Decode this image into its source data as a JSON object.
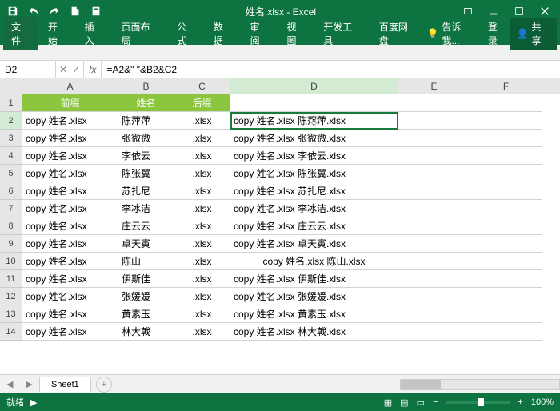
{
  "title": "姓名.xlsx - Excel",
  "ribbon": {
    "tabs": [
      "文件",
      "开始",
      "插入",
      "页面布局",
      "公式",
      "数据",
      "审阅",
      "视图",
      "开发工具",
      "百度网盘"
    ],
    "tell": "告诉我...",
    "login": "登录",
    "share": "共享"
  },
  "namebox": "D2",
  "formula": "=A2&\" \"&B2&C2",
  "columns": [
    "A",
    "B",
    "C",
    "D",
    "E",
    "F"
  ],
  "headers": {
    "A": "前缀",
    "B": "姓名",
    "C": "后缀"
  },
  "rows": [
    {
      "n": 2,
      "A": "copy 姓名.xlsx",
      "B": "陈萍萍",
      "C": ".xlsx",
      "D": "copy 姓名.xlsx 陈萍萍.xlsx"
    },
    {
      "n": 3,
      "A": "copy 姓名.xlsx",
      "B": "张微微",
      "C": ".xlsx",
      "D": "copy 姓名.xlsx 张微微.xlsx"
    },
    {
      "n": 4,
      "A": "copy 姓名.xlsx",
      "B": "李依云",
      "C": ".xlsx",
      "D": "copy 姓名.xlsx 李依云.xlsx"
    },
    {
      "n": 5,
      "A": "copy 姓名.xlsx",
      "B": "陈张翼",
      "C": ".xlsx",
      "D": "copy 姓名.xlsx 陈张翼.xlsx"
    },
    {
      "n": 6,
      "A": "copy 姓名.xlsx",
      "B": "苏扎尼",
      "C": ".xlsx",
      "D": "copy 姓名.xlsx 苏扎尼.xlsx"
    },
    {
      "n": 7,
      "A": "copy 姓名.xlsx",
      "B": "李冰洁",
      "C": ".xlsx",
      "D": "copy 姓名.xlsx 李冰洁.xlsx"
    },
    {
      "n": 8,
      "A": "copy 姓名.xlsx",
      "B": "庄云云",
      "C": ".xlsx",
      "D": "copy 姓名.xlsx 庄云云.xlsx"
    },
    {
      "n": 9,
      "A": "copy 姓名.xlsx",
      "B": "卓天寅",
      "C": ".xlsx",
      "D": "copy 姓名.xlsx 卓天寅.xlsx"
    },
    {
      "n": 10,
      "A": "copy 姓名.xlsx",
      "B": "陈山",
      "C": ".xlsx",
      "D": "copy 姓名.xlsx 陈山.xlsx"
    },
    {
      "n": 11,
      "A": "copy 姓名.xlsx",
      "B": "伊斯佳",
      "C": ".xlsx",
      "D": "copy 姓名.xlsx 伊斯佳.xlsx"
    },
    {
      "n": 12,
      "A": "copy 姓名.xlsx",
      "B": "张媛媛",
      "C": ".xlsx",
      "D": "copy 姓名.xlsx 张媛媛.xlsx"
    },
    {
      "n": 13,
      "A": "copy 姓名.xlsx",
      "B": "黄素玉",
      "C": ".xlsx",
      "D": "copy 姓名.xlsx 黄素玉.xlsx"
    },
    {
      "n": 14,
      "A": "copy 姓名.xlsx",
      "B": "林大戟",
      "C": ".xlsx",
      "D": "copy 姓名.xlsx 林大戟.xlsx"
    }
  ],
  "sheet": "Sheet1",
  "status": {
    "ready": "就绪",
    "zoom": "100%"
  }
}
